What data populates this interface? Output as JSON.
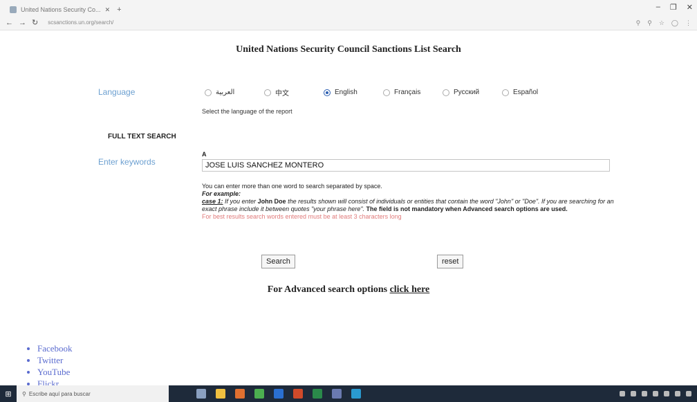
{
  "browser": {
    "tab_title": "United Nations Security Co...",
    "url": "scsanctions.un.org/search/"
  },
  "page": {
    "title": "United Nations Security Council Sanctions List Search"
  },
  "language": {
    "label": "Language",
    "options": [
      "العربية",
      "中文",
      "English",
      "Français",
      "Русский",
      "Español"
    ],
    "selected": "English",
    "help": "Select the language of the report"
  },
  "full_text_search": {
    "heading": "FULL TEXT SEARCH",
    "keywords_label": "Enter keywords",
    "marker": "A",
    "input_value": "JOSE LUIS SANCHEZ MONTERO",
    "help_line1": "You can enter more than one word to search separated by space.",
    "example_label": "For example:",
    "case_label": "case 1:",
    "case_text_a": " If you enter ",
    "case_name": "John Doe",
    "case_text_b": " the results shown will consist of individuals or entities that contain the word \"John\" or \"Doe\". If you are searching for an exact phrase include it between quotes \"your phrase here\".",
    "mandatory_note": " The field is not mandatory when Advanced search options are used.",
    "warning": "For best results search words entered must be at least 3 characters long"
  },
  "buttons": {
    "search": "Search",
    "reset": "reset"
  },
  "advanced": {
    "prefix": "For Advanced search options ",
    "link": "click here"
  },
  "social": [
    "Facebook",
    "Twitter",
    "YouTube",
    "Flickr"
  ],
  "taskbar": {
    "search_placeholder": "Escribe aquí para buscar"
  }
}
